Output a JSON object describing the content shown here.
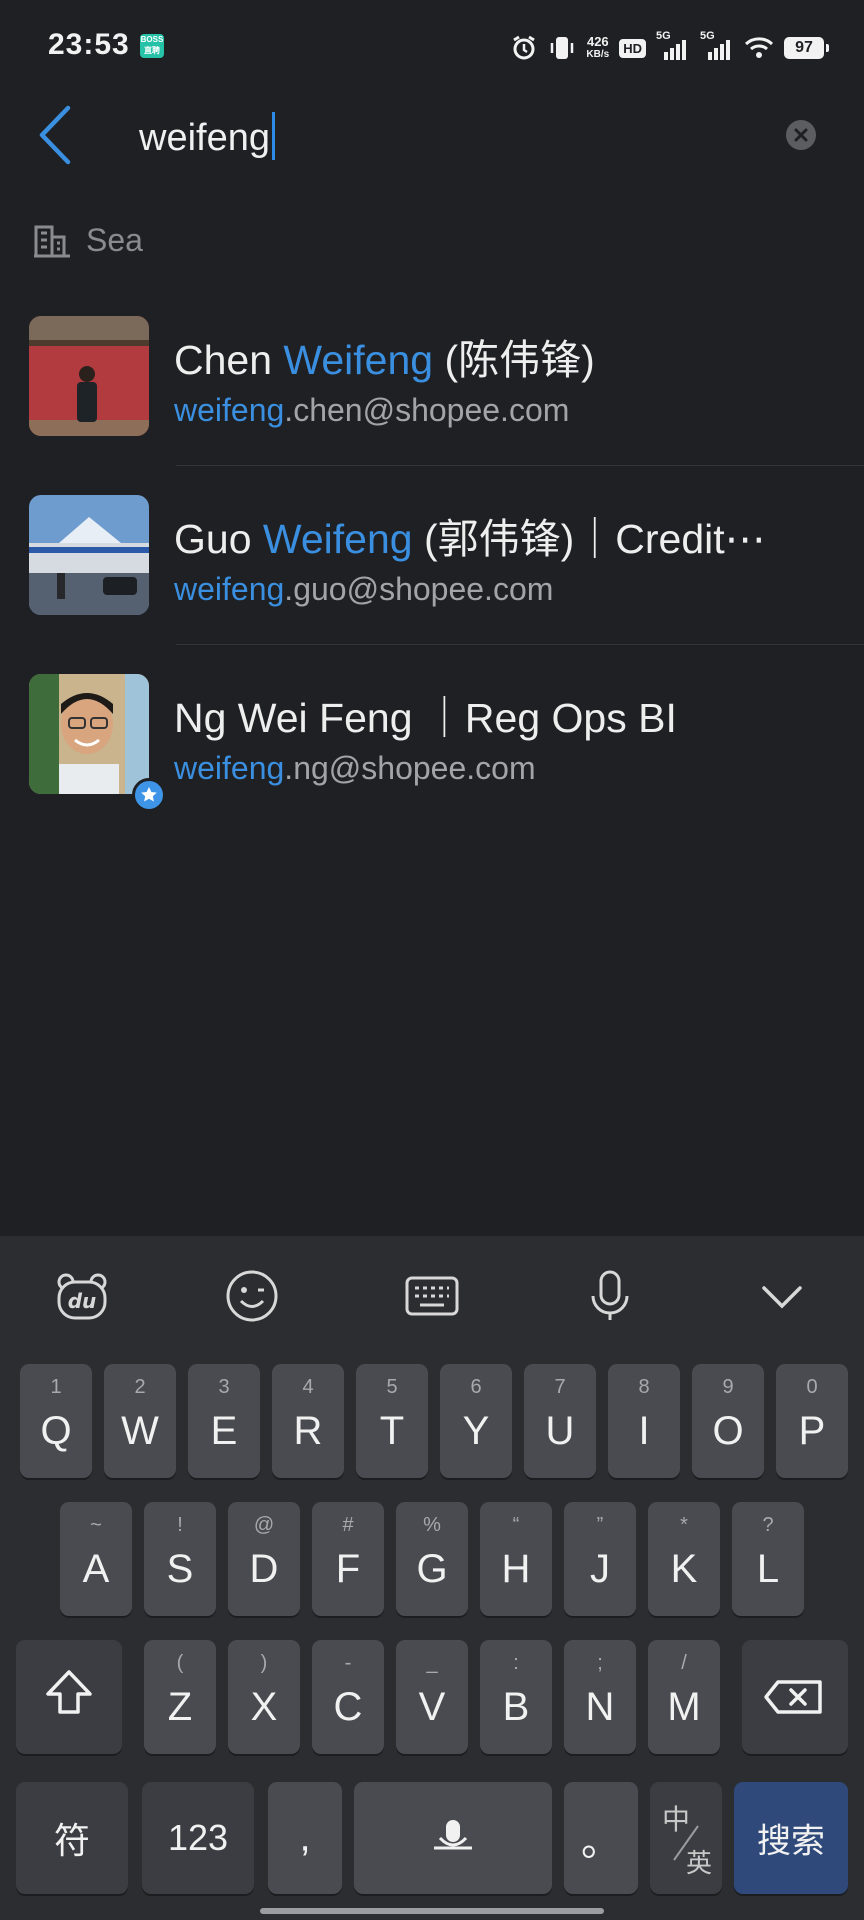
{
  "status_bar": {
    "time": "23:53",
    "app_badge": "BOSS直聘",
    "net_speed_value": "426",
    "net_speed_unit": "KB/s",
    "hd_label": "HD",
    "signal1": "5G",
    "signal2": "5G",
    "battery": "97"
  },
  "search": {
    "query": "weifeng",
    "section_label": "Sea"
  },
  "results": [
    {
      "name_prefix": "Chen ",
      "name_match": "Weifeng",
      "name_suffix": " (陈伟锋)",
      "email_match": "weifeng",
      "email_suffix": ".chen@shopee.com"
    },
    {
      "name_prefix": "Guo ",
      "name_match": "Weifeng",
      "name_suffix": " (郭伟锋)｜Credit⋯",
      "email_match": "weifeng",
      "email_suffix": ".guo@shopee.com"
    },
    {
      "name_prefix": "Ng Wei Feng ｜Reg Ops BI",
      "name_match": "",
      "name_suffix": "",
      "email_match": "weifeng",
      "email_suffix": ".ng@shopee.com"
    }
  ],
  "keyboard": {
    "toolbar": [
      "du-bear-icon",
      "emoji-icon",
      "keyboard-icon",
      "microphone-icon",
      "chevron-down-icon"
    ],
    "row1": [
      {
        "k": "Q",
        "s": "1"
      },
      {
        "k": "W",
        "s": "2"
      },
      {
        "k": "E",
        "s": "3"
      },
      {
        "k": "R",
        "s": "4"
      },
      {
        "k": "T",
        "s": "5"
      },
      {
        "k": "Y",
        "s": "6"
      },
      {
        "k": "U",
        "s": "7"
      },
      {
        "k": "I",
        "s": "8"
      },
      {
        "k": "O",
        "s": "9"
      },
      {
        "k": "P",
        "s": "0"
      }
    ],
    "row2": [
      {
        "k": "A",
        "s": "~"
      },
      {
        "k": "S",
        "s": "!"
      },
      {
        "k": "D",
        "s": "@"
      },
      {
        "k": "F",
        "s": "#"
      },
      {
        "k": "G",
        "s": "%"
      },
      {
        "k": "H",
        "s": "“"
      },
      {
        "k": "J",
        "s": "”"
      },
      {
        "k": "K",
        "s": "*"
      },
      {
        "k": "L",
        "s": "?"
      }
    ],
    "row3": [
      {
        "k": "Z",
        "s": "("
      },
      {
        "k": "X",
        "s": ")"
      },
      {
        "k": "C",
        "s": "-"
      },
      {
        "k": "V",
        "s": "_"
      },
      {
        "k": "B",
        "s": ":"
      },
      {
        "k": "N",
        "s": ";"
      },
      {
        "k": "M",
        "s": "/"
      }
    ],
    "symbols_key": "符",
    "numbers_key": "123",
    "comma_key": ",",
    "period_key": "。",
    "lang_top": "中",
    "lang_bottom": "英",
    "search_key": "搜索"
  }
}
